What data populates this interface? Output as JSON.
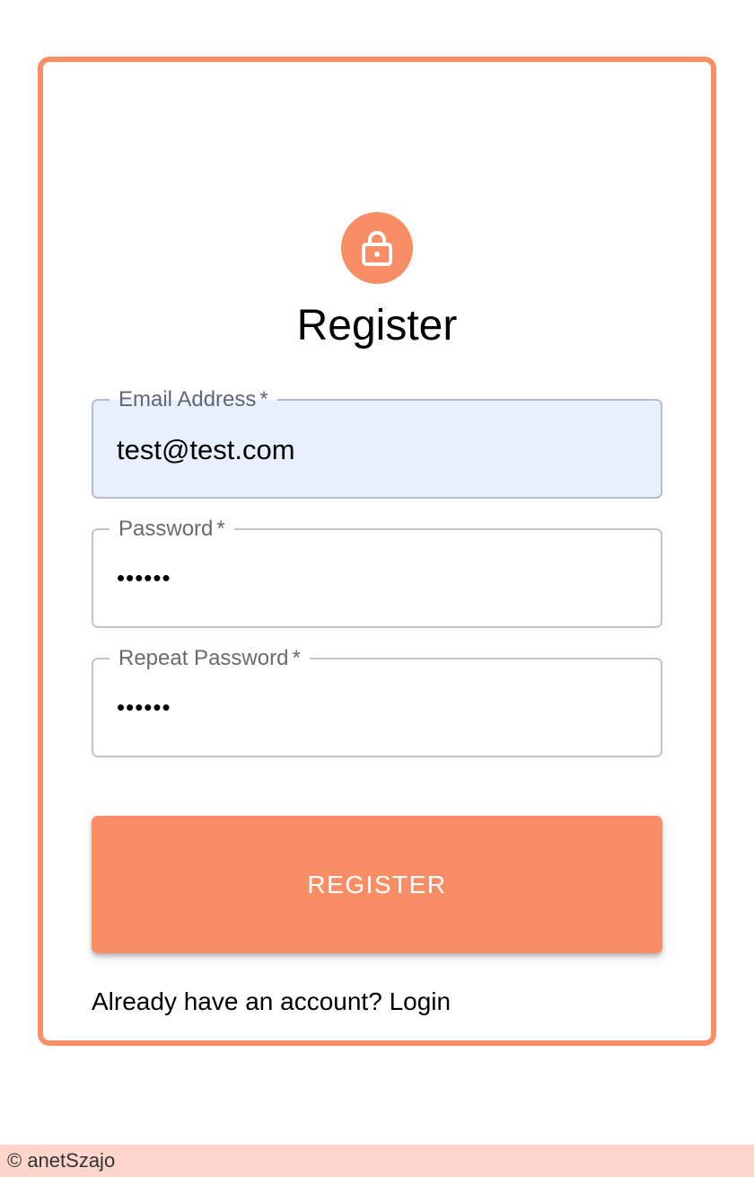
{
  "form": {
    "title": "Register",
    "email": {
      "label": "Email Address",
      "required_mark": "*",
      "value": "test@test.com"
    },
    "password": {
      "label": "Password",
      "required_mark": "*",
      "value": "••••••"
    },
    "repeat_password": {
      "label": "Repeat Password",
      "required_mark": "*",
      "value": "••••••"
    },
    "submit_label": "REGISTER",
    "login_prompt": "Already have an account?",
    "login_link": "Login"
  },
  "footer": {
    "copyright": "© anetSzajo"
  },
  "icons": {
    "avatar": "lock-icon"
  },
  "colors": {
    "accent": "#F98E66",
    "autofill_bg": "#E8F0FE",
    "footer_bg": "#FDD5CB"
  }
}
